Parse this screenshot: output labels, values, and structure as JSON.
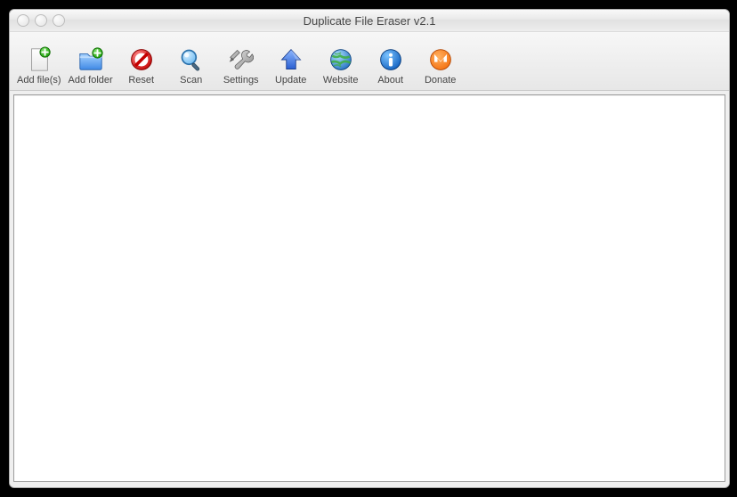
{
  "window": {
    "title": "Duplicate File Eraser v2.1"
  },
  "toolbar": {
    "items": [
      {
        "id": "add-files",
        "label": "Add file(s)",
        "icon": "add-file-icon"
      },
      {
        "id": "add-folder",
        "label": "Add folder",
        "icon": "add-folder-icon"
      },
      {
        "id": "reset",
        "label": "Reset",
        "icon": "reset-icon"
      },
      {
        "id": "scan",
        "label": "Scan",
        "icon": "scan-icon"
      },
      {
        "id": "settings",
        "label": "Settings",
        "icon": "settings-icon"
      },
      {
        "id": "update",
        "label": "Update",
        "icon": "update-icon"
      },
      {
        "id": "website",
        "label": "Website",
        "icon": "website-icon"
      },
      {
        "id": "about",
        "label": "About",
        "icon": "about-icon"
      },
      {
        "id": "donate",
        "label": "Donate",
        "icon": "donate-icon"
      }
    ]
  }
}
